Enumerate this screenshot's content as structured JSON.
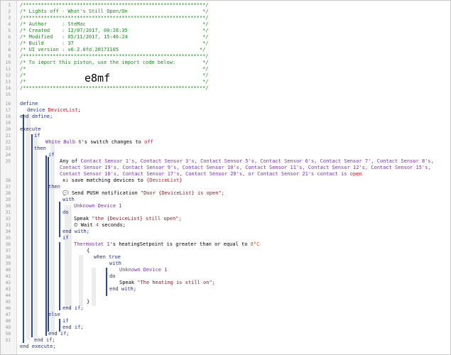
{
  "line_numbers": [
    "1",
    "2",
    "3",
    "4",
    "5",
    "6",
    "7",
    "8",
    "9",
    "10",
    "11",
    "12",
    "13",
    "14",
    "15",
    "16",
    "17",
    "18",
    "19",
    "20",
    "21",
    "22",
    "23",
    "24",
    "25",
    "26",
    "27",
    "28",
    "29",
    "30",
    "31",
    "32",
    "33",
    "34",
    "35",
    "36",
    "37",
    "38",
    "39",
    "40",
    "41",
    "42",
    "43",
    "44",
    "45",
    "46",
    "47",
    "48",
    "49",
    "50",
    "51"
  ],
  "code": {
    "stars": "/*************************************************************/",
    "title": "/* Lights off - What's Still Open/On                         */",
    "author": "/* Author     : SteMac                                       */",
    "created": "/* Created    : 12/07/2017, 00:28:35                         */",
    "modified": "/* Modified   : 05/11/2017, 15:46:24                         */",
    "build": "/* Build      : 37                                           */",
    "ui_version": "/* UI version : v0.2.0fd.20171105                           */",
    "import_hint": "/* To import this piston, use the import code below:         */",
    "blank_comment": "/*                                                           */",
    "import_code": "e8mf",
    "define": "define",
    "device_kw": "device",
    "device_name": "DeviceList",
    "end_define": "end define;",
    "execute": "execute",
    "if_kw": "if",
    "then_kw": "then",
    "else_kw": "else",
    "end_if": "end if;",
    "end_execute": "end execute;",
    "with_kw": "with",
    "do_kw": "do",
    "end_with": "end with;",
    "bulb_device": "White Bulb 6",
    "bulb_attr": "'s switch changes to ",
    "bulb_value": "off",
    "any_of": "Any of",
    "sensors_line1": "Contact Sensor 1's, Contact Sensor 3's, Contact Sensor 5's, Contact Sensor 6's, Contact Sensor 7', Contact Sensor 8's,",
    "sensors_line2": "Contact Sensor 19's, Contact Sensor 9's, Contact Sensor 10's, Contact Sensor 11's, Contact Sensor 12's, Contact Sensor 15's,",
    "sensors_line3": "Contact Sensor 16's, Contact Sensor 17's, Contact Sensor 20's, or Contact Sensor 21's contact is",
    "contact_value": "open",
    "save_matching": "save matching devices to",
    "save_target": "{DeviceList}",
    "push_label": "Send PUSH notification",
    "push_message": "\"Door {DeviceList} is open\";",
    "unknown_device": "Unknown Device 1",
    "speak_label": "Speak",
    "speak_still_open": "\"the {DeviceList} still open\";",
    "wait_label": "Wait",
    "wait_value": "4",
    "wait_unit": "seconds;",
    "thermostat_device": "Thermostat 1",
    "thermostat_attr": "'s heatingSetpoint is greater than or equal to ",
    "thermostat_value": "8°C",
    "open_brace": "{",
    "close_brace": "}",
    "when_true": "when true",
    "speak_heating": "\"The heating is still on\";",
    "x_marker": "x₂",
    "line22_marker": "x₂"
  },
  "colors": {
    "comment": "#1c8a1c",
    "keyword": "#1b2f8f",
    "device": "#7a2db5",
    "value": "#c81e1e",
    "string": "#8b1a1a",
    "number": "#c75a00"
  }
}
